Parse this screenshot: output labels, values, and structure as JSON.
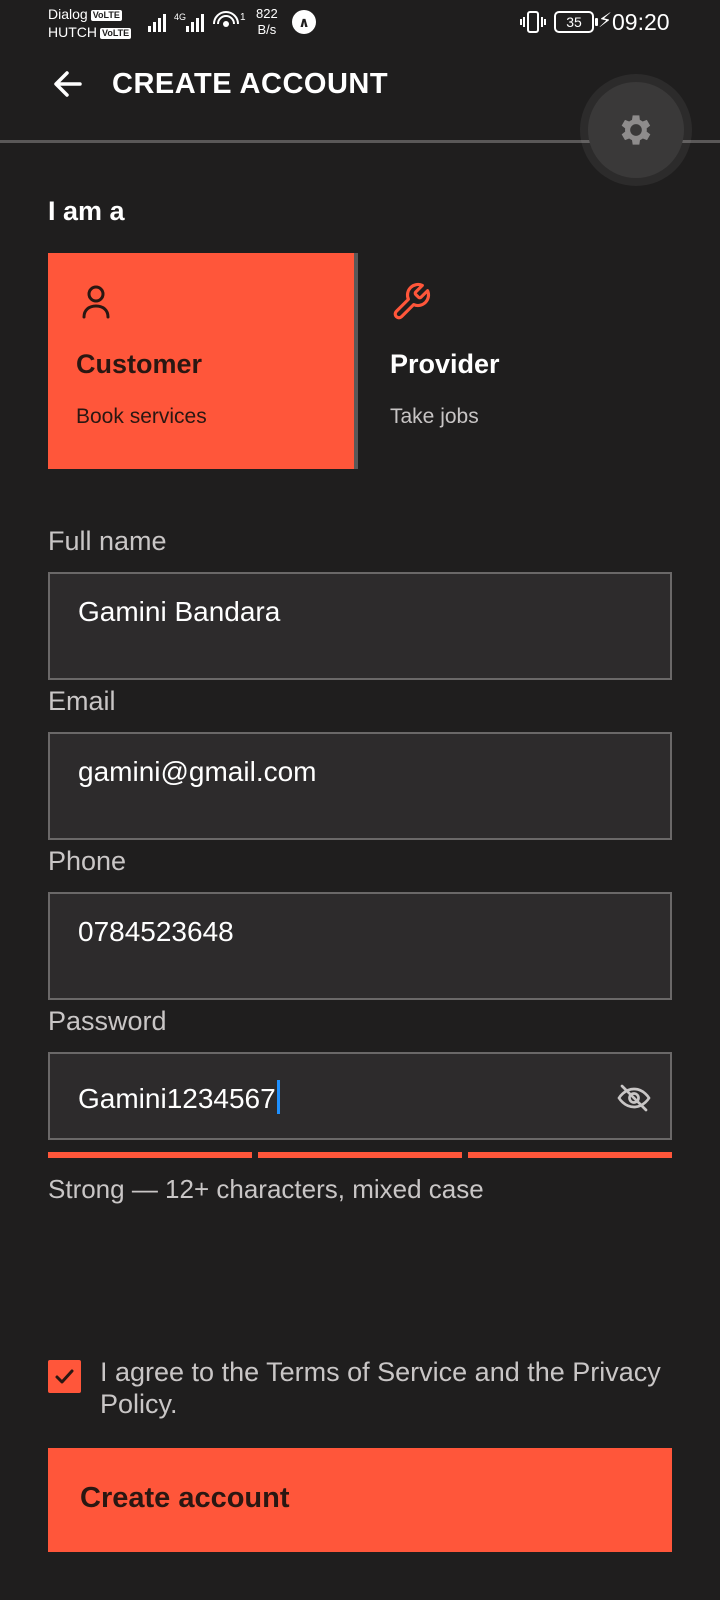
{
  "status_bar": {
    "carrier_1": "Dialog",
    "carrier_2": "HUTCH",
    "volte_badge": "VoLTE",
    "network_type": "4G",
    "hotspot_count": "1",
    "speed_value": "822",
    "speed_unit": "B/s",
    "battery": "35",
    "time": "09:20"
  },
  "header": {
    "title": "CREATE ACCOUNT"
  },
  "role": {
    "heading": "I am a",
    "options": [
      {
        "title": "Customer",
        "subtitle": "Book services",
        "icon": "person-icon",
        "selected": true
      },
      {
        "title": "Provider",
        "subtitle": "Take jobs",
        "icon": "wrench-icon",
        "selected": false
      }
    ]
  },
  "form": {
    "full_name": {
      "label": "Full name",
      "value": "Gamini Bandara"
    },
    "email": {
      "label": "Email",
      "value": "gamini@gmail.com"
    },
    "phone": {
      "label": "Phone",
      "value": "0784523648"
    },
    "password": {
      "label": "Password",
      "value": "Gamini1234567",
      "visible": true
    },
    "strength": {
      "text": "Strong — 12+ characters, mixed case",
      "segments_filled": 3,
      "segments_total": 3
    }
  },
  "agreement": {
    "checked": true,
    "text": "I agree to the Terms of Service and the Privacy Policy."
  },
  "submit": {
    "label": "Create account"
  },
  "colors": {
    "background": "#1f1e1e",
    "accent": "#ff563a",
    "field_bg": "#2d2b2c",
    "field_border": "#6a6868",
    "muted_text": "#c9c6c6"
  }
}
